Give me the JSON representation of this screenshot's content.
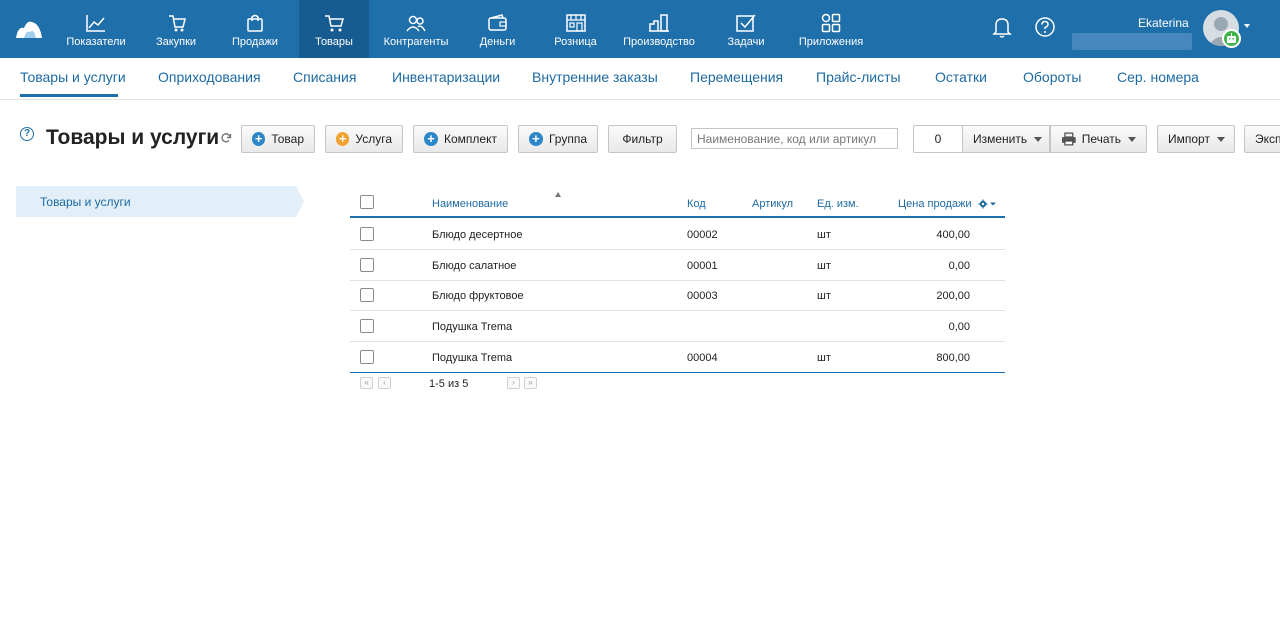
{
  "topnav": {
    "items": [
      {
        "label": "Показатели",
        "icon": "chart-line-icon"
      },
      {
        "label": "Закупки",
        "icon": "cart-hand-icon"
      },
      {
        "label": "Продажи",
        "icon": "shopping-bag-icon"
      },
      {
        "label": "Товары",
        "icon": "cart-icon"
      },
      {
        "label": "Контрагенты",
        "icon": "people-icon"
      },
      {
        "label": "Деньги",
        "icon": "wallet-icon"
      },
      {
        "label": "Розница",
        "icon": "store-icon"
      },
      {
        "label": "Производство",
        "icon": "factory-icon"
      },
      {
        "label": "Задачи",
        "icon": "checkbox-icon"
      },
      {
        "label": "Приложения",
        "icon": "apps-grid-icon"
      }
    ],
    "active": "Товары",
    "user_name": "Ekaterina"
  },
  "subnav": {
    "items": [
      "Товары и услуги",
      "Оприходования",
      "Списания",
      "Инвентаризации",
      "Внутренние заказы",
      "Перемещения",
      "Прайс-листы",
      "Остатки",
      "Обороты",
      "Сер. номера"
    ],
    "active": "Товары и услуги"
  },
  "toolbar": {
    "help": "?",
    "title": "Товары и услуги",
    "btn_product": "Товар",
    "btn_service": "Услуга",
    "btn_kit": "Комплект",
    "btn_group": "Группа",
    "btn_filter": "Фильтр",
    "search_placeholder": "Наименование, код или артикул",
    "selected_count": "0",
    "btn_change": "Изменить",
    "btn_print": "Печать",
    "btn_import": "Импорт",
    "btn_export": "Эксп"
  },
  "sidebar": {
    "folder": "Товары и услуги"
  },
  "table": {
    "headers": {
      "name": "Наименование",
      "code": "Код",
      "article": "Артикул",
      "unit": "Ед. изм.",
      "price": "Цена продажи"
    },
    "rows": [
      {
        "name": "Блюдо десертное",
        "code": "00002",
        "article": "",
        "unit": "шт",
        "price": "400,00"
      },
      {
        "name": "Блюдо салатное",
        "code": "00001",
        "article": "",
        "unit": "шт",
        "price": "0,00"
      },
      {
        "name": "Блюдо фруктовое",
        "code": "00003",
        "article": "",
        "unit": "шт",
        "price": "200,00"
      },
      {
        "name": "Подушка Trema",
        "code": "",
        "article": "",
        "unit": "",
        "price": "0,00"
      },
      {
        "name": "Подушка Trema",
        "code": "00004",
        "article": "",
        "unit": "шт",
        "price": "800,00"
      }
    ],
    "pager": "1-5 из 5"
  },
  "colors": {
    "brand": "#1f6fab",
    "active_nav": "#175c91",
    "link": "#1e6aa3",
    "folder_bg": "#e2eff8"
  }
}
